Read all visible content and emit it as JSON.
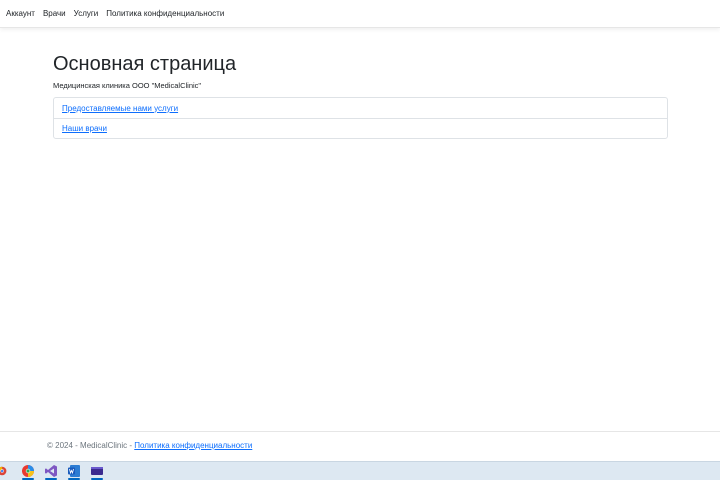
{
  "nav": {
    "items": [
      {
        "label": "Аккаунт"
      },
      {
        "label": "Врачи"
      },
      {
        "label": "Услуги"
      },
      {
        "label": "Политика конфиденциальности"
      }
    ]
  },
  "main": {
    "title": "Основная страница",
    "subtitle": "Медицинская клиника ООО \"MedicalClinic\"",
    "links": [
      {
        "label": "Предоставляемые нами услуги"
      },
      {
        "label": "Наши врачи"
      }
    ]
  },
  "footer": {
    "copyright": "© 2024 - MedicalClinic - ",
    "privacy_link": "Политика конфиденциальности"
  },
  "taskbar": {
    "apps": [
      "chrome-icon",
      "yandex-browser-icon",
      "visual-studio-icon",
      "word-icon",
      "terminal-icon"
    ]
  }
}
